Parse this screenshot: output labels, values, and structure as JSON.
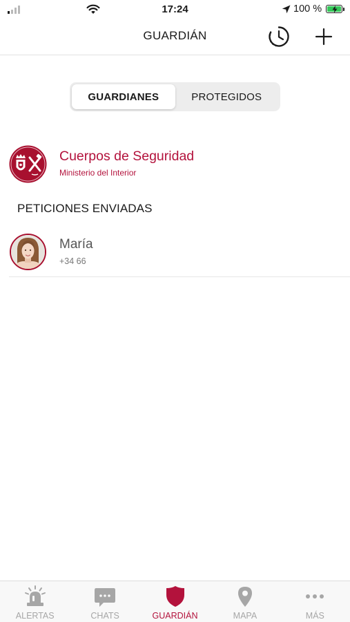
{
  "status_bar": {
    "time": "17:24",
    "battery_percent": "100 %",
    "signal_icon": "cellular-signal-icon",
    "wifi_icon": "wifi-icon",
    "location_icon": "location-arrow-icon",
    "battery_icon": "battery-charging-icon",
    "battery_color": "#34c759"
  },
  "nav": {
    "title": "GUARDIÁN",
    "history_icon": "history-clock-icon",
    "add_icon": "plus-icon"
  },
  "segments": [
    {
      "label": "GUARDIANES",
      "active": true
    },
    {
      "label": "PROTEGIDOS",
      "active": false
    }
  ],
  "organization": {
    "name": "Cuerpos de Seguridad",
    "subtitle": "Ministerio del Interior",
    "avatar_icon": "security-forces-emblem-icon"
  },
  "section_header": "PETICIONES ENVIADAS",
  "sent_requests": [
    {
      "name": "María",
      "phone": "+34 66",
      "avatar_icon": "user-photo-avatar"
    }
  ],
  "tab_bar": {
    "tabs": [
      {
        "label": "ALERTAS",
        "icon": "siren-icon",
        "active": false
      },
      {
        "label": "CHATS",
        "icon": "chat-bubble-icon",
        "active": false
      },
      {
        "label": "GUARDIÁN",
        "icon": "shield-icon",
        "active": true
      },
      {
        "label": "MAPA",
        "icon": "map-pin-icon",
        "active": false
      },
      {
        "label": "MÁS",
        "icon": "more-dots-icon",
        "active": false
      }
    ]
  },
  "colors": {
    "accent": "#b3123c",
    "inactive": "#a6a6a6",
    "segment_bg": "#ededed"
  }
}
